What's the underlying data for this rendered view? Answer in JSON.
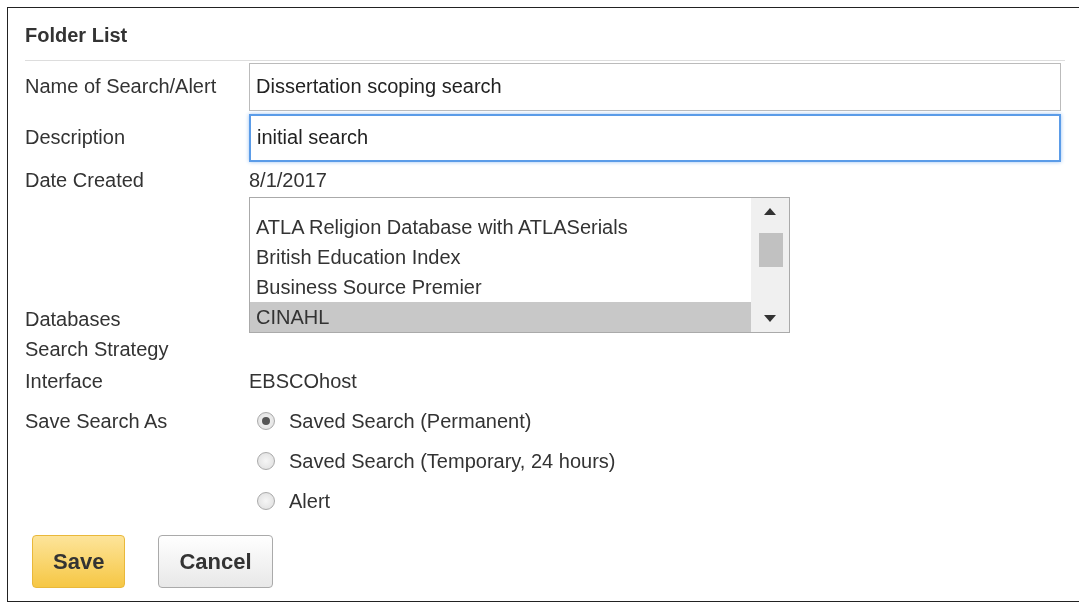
{
  "panel": {
    "title": "Folder List"
  },
  "fields": [
    {
      "label": "Name of Search/Alert",
      "value": "Dissertation scoping search",
      "focused": false
    },
    {
      "label": "Description",
      "value": "initial search",
      "focused": true
    }
  ],
  "date_created": {
    "label": "Date Created",
    "value": "8/1/2017"
  },
  "databases": {
    "label": "Databases",
    "items": [
      {
        "label": "ATLA Religion Database with ATLASerials",
        "selected": false
      },
      {
        "label": "British Education Index",
        "selected": false
      },
      {
        "label": "Business Source Premier",
        "selected": false
      },
      {
        "label": "CINAHL",
        "selected": true
      }
    ]
  },
  "search_strategy": {
    "label": "Search Strategy"
  },
  "interface": {
    "label": "Interface",
    "value": "EBSCOhost"
  },
  "save_as": {
    "label": "Save Search As",
    "options": [
      {
        "label": "Saved Search (Permanent)",
        "selected": true
      },
      {
        "label": "Saved Search (Temporary, 24 hours)",
        "selected": false
      },
      {
        "label": "Alert",
        "selected": false
      }
    ]
  },
  "buttons": [
    {
      "label": "Save",
      "kind": "primary"
    },
    {
      "label": "Cancel",
      "kind": "secondary"
    }
  ]
}
